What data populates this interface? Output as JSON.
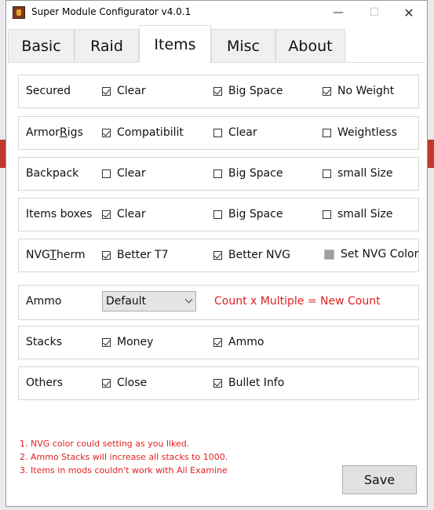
{
  "window": {
    "title": "Super Module Configurator v4.0.1"
  },
  "tabs": [
    "Basic",
    "Raid",
    "Items",
    "Misc",
    "About"
  ],
  "active_tab": "Items",
  "groups": {
    "secured": {
      "label": "Secured",
      "options": [
        {
          "label": "Clear",
          "checked": true
        },
        {
          "label": "Big Space",
          "checked": true
        },
        {
          "label": "No Weight",
          "checked": true
        }
      ]
    },
    "armorrigs": {
      "label_pre": "Armor",
      "label_u": "R",
      "label_post": "igs",
      "options": [
        {
          "label": "Compatibilit",
          "checked": true
        },
        {
          "label": "Clear",
          "checked": false
        },
        {
          "label": "Weightless",
          "checked": false
        }
      ]
    },
    "backpack": {
      "label": "Backpack",
      "options": [
        {
          "label": "Clear",
          "checked": false
        },
        {
          "label": "Big Space",
          "checked": false
        },
        {
          "label": "small Size",
          "checked": false
        }
      ]
    },
    "itemsboxes": {
      "label": "Items boxes",
      "options": [
        {
          "label": "Clear",
          "checked": true
        },
        {
          "label": "Big Space",
          "checked": false
        },
        {
          "label": "small Size",
          "checked": false
        }
      ]
    },
    "nvgtherm": {
      "label_pre": "NVG",
      "label_u": "T",
      "label_post": "herm",
      "options": [
        {
          "label": "Better T7",
          "checked": true
        },
        {
          "label": "Better NVG",
          "checked": true
        },
        {
          "label": "Set NVG Color",
          "checked": false
        }
      ]
    },
    "ammo": {
      "label": "Ammo",
      "select_value": "Default",
      "formula": "Count x Multiple = New Count"
    },
    "stacks": {
      "label": "Stacks",
      "options": [
        {
          "label": "Money",
          "checked": true
        },
        {
          "label": "Ammo",
          "checked": true
        }
      ]
    },
    "others": {
      "label": "Others",
      "options": [
        {
          "label": "Close",
          "checked": true
        },
        {
          "label": "Bullet Info",
          "checked": true
        }
      ]
    }
  },
  "notes": [
    "1. NVG color could setting as you liked.",
    "2. Ammo Stacks will increase all stacks to 1000.",
    "3. Items in mods couldn't work with All Examine"
  ],
  "save_label": "Save",
  "colors": {
    "note": "#e02020",
    "window_bg": "#ffffff",
    "tab_bg": "#f0f0f0"
  }
}
